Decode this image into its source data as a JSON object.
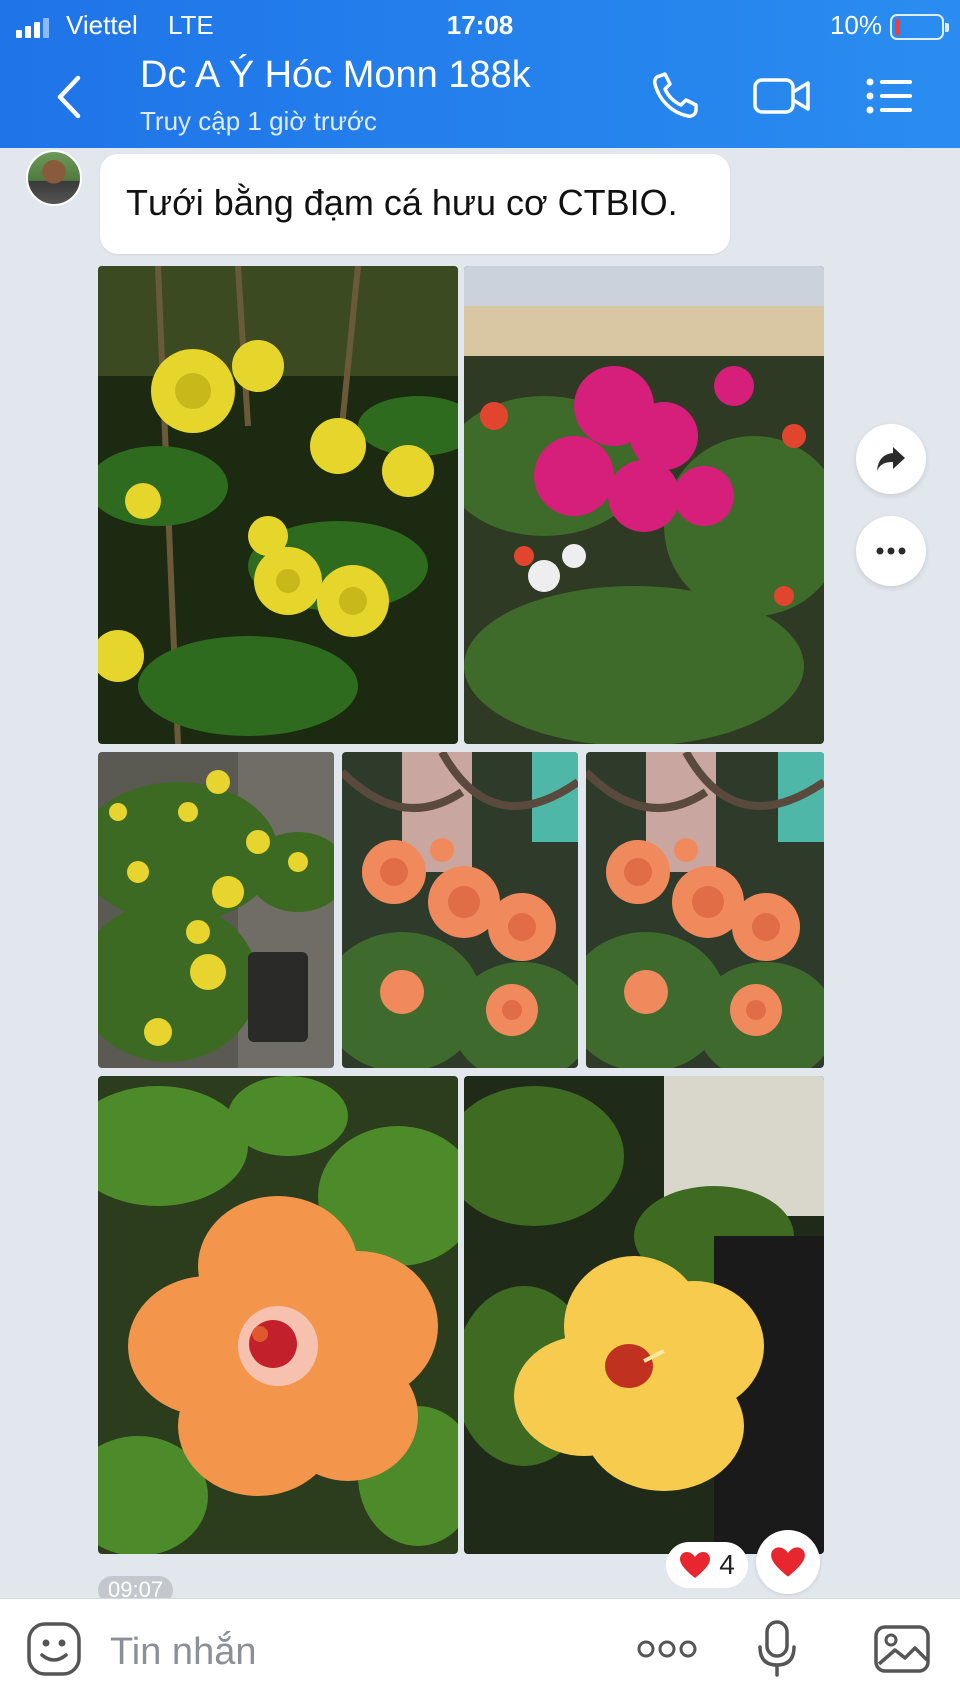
{
  "status_bar": {
    "carrier": "Viettel",
    "network": "LTE",
    "time": "17:08",
    "battery": "10%",
    "battery_level": 0.1
  },
  "header": {
    "title": "Dc A Ý Hóc Monn 188k",
    "subtitle": "Truy cập 1 giờ trước",
    "icons": [
      "back-icon",
      "phone-icon",
      "video-call-icon",
      "menu-icon"
    ]
  },
  "message": {
    "text": "Tưới bằng đạm cá hưu cơ CTBIO.",
    "time": "09:07",
    "reaction_count": "4",
    "reaction_icon": "heart-icon"
  },
  "photos": [
    {
      "subject": "yellow marigolds"
    },
    {
      "subject": "pink bougainvillea"
    },
    {
      "subject": "yellow marigolds in pots"
    },
    {
      "subject": "orange roses"
    },
    {
      "subject": "orange roses"
    },
    {
      "subject": "orange hibiscus"
    },
    {
      "subject": "yellow hibiscus"
    }
  ],
  "composer": {
    "placeholder": "Tin nhắn",
    "icons": [
      "emoji-icon",
      "more-dots-icon",
      "microphone-icon",
      "image-icon"
    ]
  },
  "colors": {
    "header": "#2a80ee",
    "chat_bg": "#e2e7ee",
    "heart": "#e8262f"
  }
}
